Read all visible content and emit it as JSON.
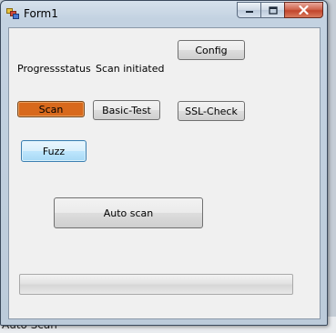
{
  "window": {
    "title": "Form1"
  },
  "labels": {
    "progress_status": "Progressstatus",
    "scan_status": "Scan initiated"
  },
  "buttons": {
    "config": "Config",
    "scan": "Scan",
    "basic_test": "Basic-Test",
    "ssl_check": "SSL-Check",
    "fuzz": "Fuzz",
    "auto_scan": "Auto scan"
  },
  "progress_bar": {
    "value_percent": 0
  },
  "background": {
    "taskbar_text": "Auto Scan"
  },
  "colors": {
    "scan_button": "#d8691c",
    "client_bg": "#f0f0f0",
    "close_button": "#c2452b"
  },
  "icons": {
    "app": "form-app-icon",
    "minimize": "minimize-icon",
    "maximize": "maximize-icon",
    "close": "close-icon"
  }
}
